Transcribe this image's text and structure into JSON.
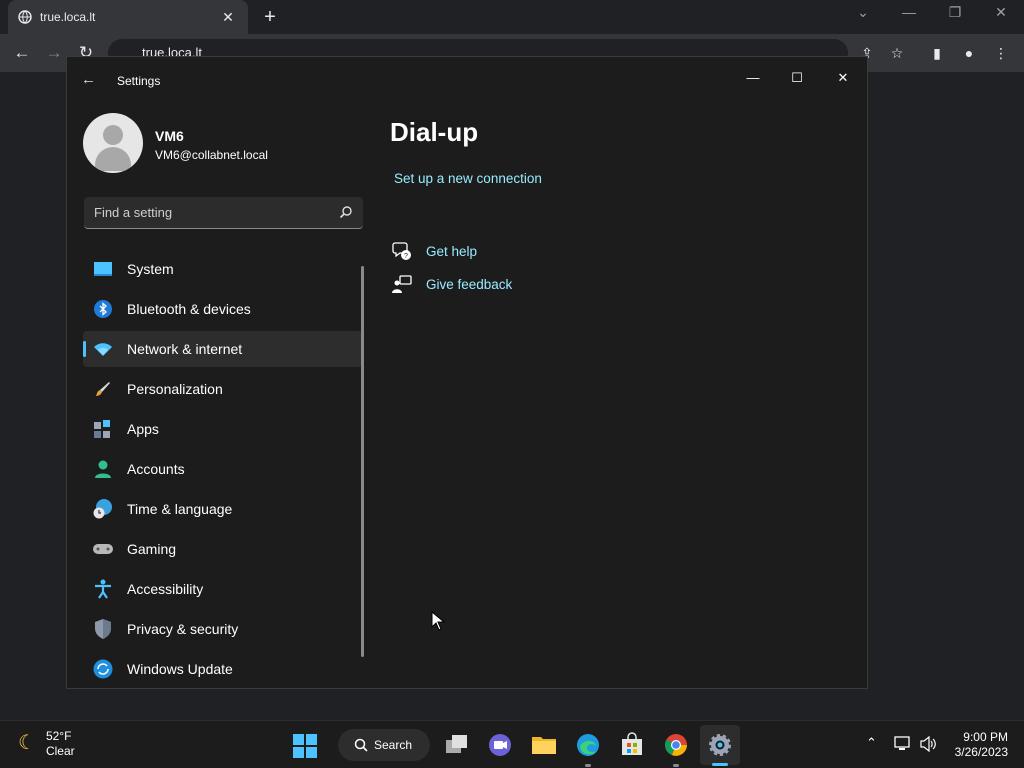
{
  "browser": {
    "tab_title": "true.loca.lt",
    "url": "true.loca.lt"
  },
  "settings": {
    "window_title": "Settings",
    "user": {
      "name": "VM6",
      "email": "VM6@collabnet.local"
    },
    "search_placeholder": "Find a setting",
    "nav": [
      {
        "label": "System",
        "icon": "system-icon",
        "selected": false
      },
      {
        "label": "Bluetooth & devices",
        "icon": "bluetooth-icon",
        "selected": false
      },
      {
        "label": "Network & internet",
        "icon": "wifi-icon",
        "selected": true
      },
      {
        "label": "Personalization",
        "icon": "brush-icon",
        "selected": false
      },
      {
        "label": "Apps",
        "icon": "apps-icon",
        "selected": false
      },
      {
        "label": "Accounts",
        "icon": "account-icon",
        "selected": false
      },
      {
        "label": "Time & language",
        "icon": "globe-clock-icon",
        "selected": false
      },
      {
        "label": "Gaming",
        "icon": "gamepad-icon",
        "selected": false
      },
      {
        "label": "Accessibility",
        "icon": "accessibility-icon",
        "selected": false
      },
      {
        "label": "Privacy & security",
        "icon": "shield-icon",
        "selected": false
      },
      {
        "label": "Windows Update",
        "icon": "update-icon",
        "selected": false
      }
    ],
    "page_title": "Dial-up",
    "setup_link": "Set up a new connection",
    "help_link": "Get help",
    "feedback_link": "Give feedback"
  },
  "taskbar": {
    "weather_temp": "52°F",
    "weather_desc": "Clear",
    "search_label": "Search",
    "time": "9:00 PM",
    "date": "3/26/2023"
  },
  "colors": {
    "accent": "#4cc2ff",
    "link": "#99ebff"
  }
}
